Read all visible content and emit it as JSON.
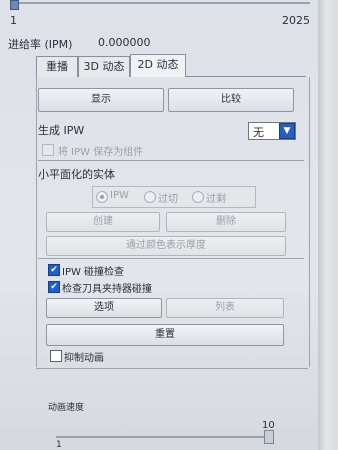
{
  "slider_top": {
    "min": "1",
    "max": "2025"
  },
  "feed_rate": {
    "label": "进给率 (IPM)",
    "value": "0.000000"
  },
  "tabs": [
    {
      "label": "重播"
    },
    {
      "label": "3D 动态"
    },
    {
      "label": "2D 动态"
    }
  ],
  "buttons": {
    "display": "显示",
    "compare": "比较"
  },
  "generate_ipw": {
    "label": "生成 IPW",
    "selected": "无"
  },
  "save_ipw_component": "将 IPW 保存为组件",
  "small_facet": {
    "title": "小平面化的实体",
    "radios": [
      "IPW",
      "过切",
      "过剩"
    ],
    "create": "创建",
    "delete": "删除",
    "color_thickness": "通过颜色表示厚度"
  },
  "ipw_collision": "IPW 碰撞检查",
  "tool_holder_collision": "检查刀具夹持器碰撞",
  "options_button": "选项",
  "list_button": "列表",
  "reset_button": "重置",
  "suppress_animation": "抑制动画",
  "animation_speed": {
    "label": "动画速度",
    "max": "10",
    "min": "1"
  },
  "colors": {
    "accent": "#1e5fd0",
    "panel": "#e3e5ea"
  }
}
